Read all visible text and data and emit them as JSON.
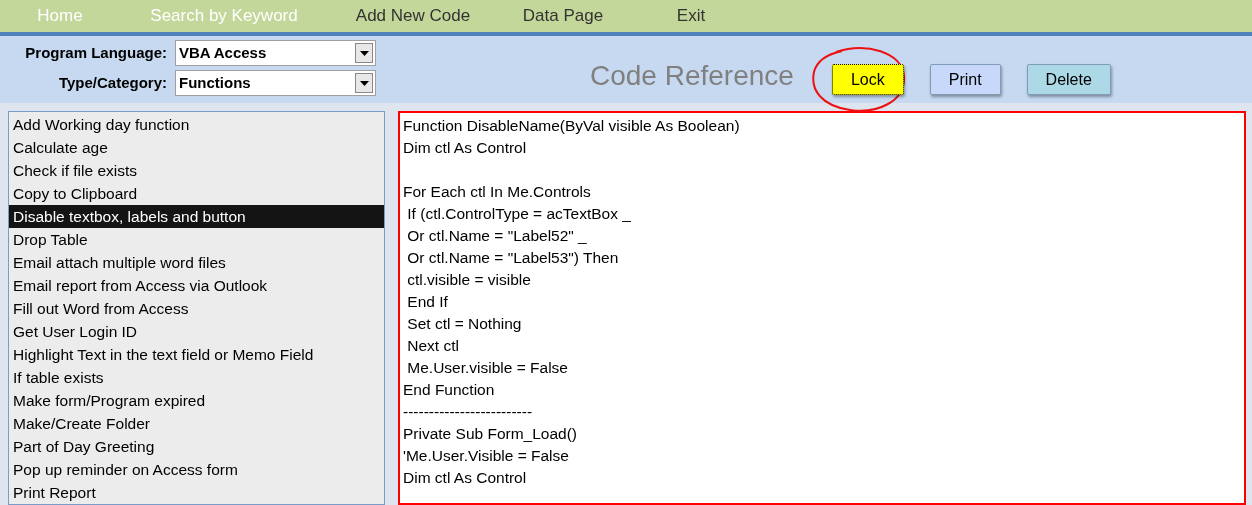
{
  "nav": [
    {
      "label": "Home",
      "highlighted": true
    },
    {
      "label": "Search by Keyword",
      "highlighted": true
    },
    {
      "label": "Add New Code",
      "highlighted": false
    },
    {
      "label": "Data Page",
      "highlighted": false
    },
    {
      "label": "Exit",
      "highlighted": false
    }
  ],
  "filters": [
    {
      "label": "Program Language:",
      "value": "VBA Access"
    },
    {
      "label": "Type/Category:",
      "value": "Functions"
    }
  ],
  "title": "Code Reference",
  "buttons": [
    {
      "label": "Lock",
      "color": "#ffff00",
      "focused": true,
      "circled": true
    },
    {
      "label": "Print",
      "color": "#c8d8fa",
      "focused": false,
      "circled": false
    },
    {
      "label": "Delete",
      "color": "#add8e6",
      "focused": false,
      "circled": false
    }
  ],
  "list": [
    {
      "label": "Add Working day function",
      "selected": false
    },
    {
      "label": "Calculate age",
      "selected": false
    },
    {
      "label": "Check if file exists",
      "selected": false
    },
    {
      "label": "Copy to Clipboard",
      "selected": false
    },
    {
      "label": "Disable textbox, labels and button",
      "selected": true
    },
    {
      "label": "Drop Table",
      "selected": false
    },
    {
      "label": "Email attach multiple word files",
      "selected": false
    },
    {
      "label": "Email report from Access via Outlook",
      "selected": false
    },
    {
      "label": "Fill out Word from Access",
      "selected": false
    },
    {
      "label": "Get User Login ID",
      "selected": false
    },
    {
      "label": "Highlight Text in the text field or Memo Field",
      "selected": false
    },
    {
      "label": "If table exists",
      "selected": false
    },
    {
      "label": "Make form/Program expired",
      "selected": false
    },
    {
      "label": "Make/Create Folder",
      "selected": false
    },
    {
      "label": "Part of Day Greeting",
      "selected": false
    },
    {
      "label": "Pop up reminder on Access form",
      "selected": false
    },
    {
      "label": "Print Report",
      "selected": false
    }
  ],
  "code": "Function DisableName(ByVal visible As Boolean)\nDim ctl As Control\n\nFor Each ctl In Me.Controls\n If (ctl.ControlType = acTextBox _\n Or ctl.Name = \"Label52\" _\n Or ctl.Name = \"Label53\") Then\n ctl.visible = visible\n End If\n Set ctl = Nothing\n Next ctl\n Me.User.visible = False\nEnd Function\n-------------------------\nPrivate Sub Form_Load()\n'Me.User.Visible = False\nDim ctl As Control"
}
